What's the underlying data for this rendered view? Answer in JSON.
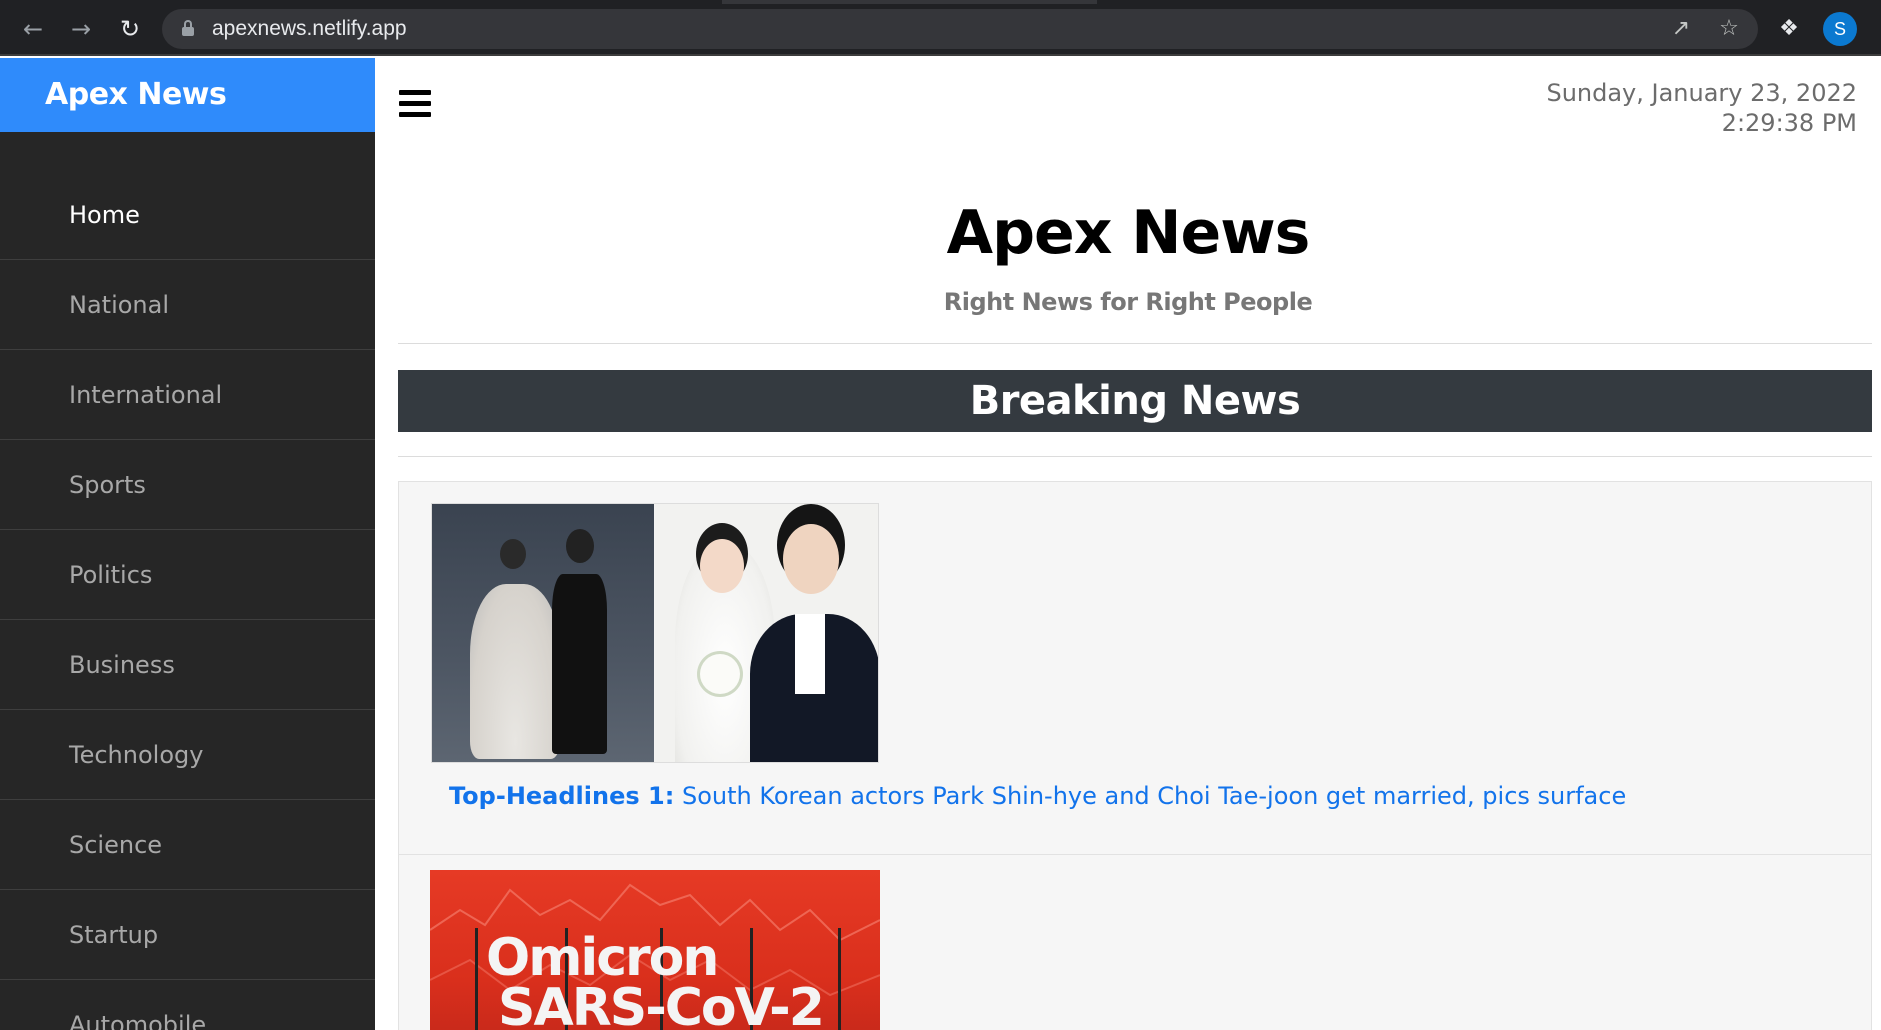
{
  "browser": {
    "url": "apexnews.netlify.app",
    "profile_initial": "S",
    "icons": {
      "back": "back-arrow-icon",
      "forward": "forward-arrow-icon",
      "reload": "reload-icon",
      "lock": "lock-icon",
      "share": "share-icon",
      "bookmark": "star-icon",
      "extensions": "puzzle-icon"
    }
  },
  "sidebar": {
    "brand": "Apex News",
    "items": [
      {
        "label": "Home",
        "active": true
      },
      {
        "label": "National"
      },
      {
        "label": "International"
      },
      {
        "label": "Sports"
      },
      {
        "label": "Politics"
      },
      {
        "label": "Business"
      },
      {
        "label": "Technology"
      },
      {
        "label": "Science"
      },
      {
        "label": "Startup"
      },
      {
        "label": "Automobile"
      }
    ]
  },
  "header": {
    "date": "Sunday, January 23, 2022",
    "time": "2:29:38 PM",
    "site_title": "Apex News",
    "tagline": "Right News for Right People"
  },
  "breaking": {
    "title": "Breaking News"
  },
  "articles": [
    {
      "label": "Top-Headlines 1:",
      "headline": "South Korean actors Park Shin-hye and Choi Tae-joon get married, pics surface"
    },
    {
      "image_text_line1": "Omicron",
      "image_text_line2": "SARS-CoV-2"
    }
  ],
  "colors": {
    "brand_blue": "#2f8bfb",
    "sidebar_bg": "#262626",
    "breaking_bg": "#343a40",
    "headline_link": "#1273eb"
  }
}
